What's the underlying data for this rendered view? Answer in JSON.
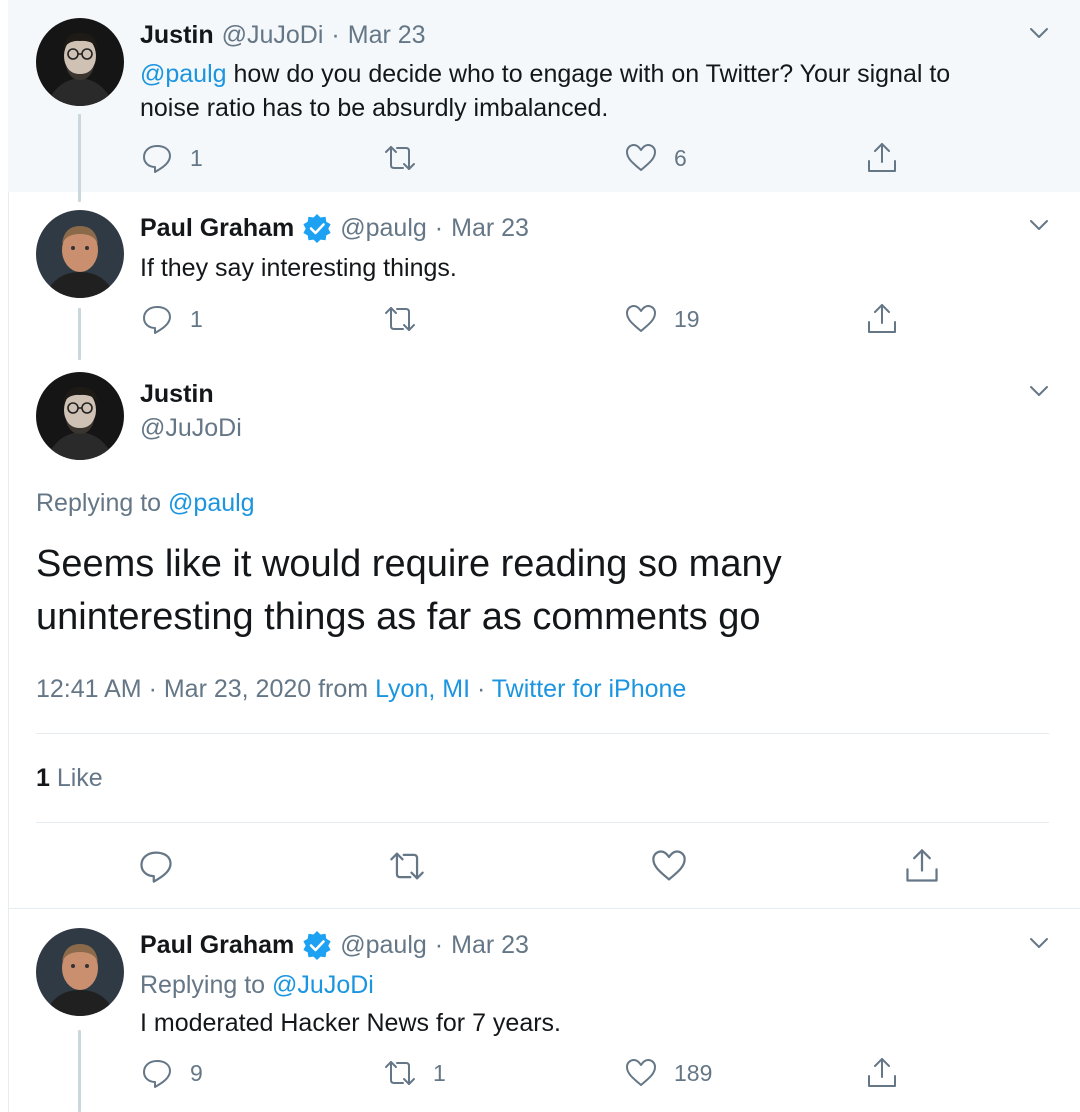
{
  "tweets": [
    {
      "name": "Justin",
      "handle": "@JuJoDi",
      "date": "Mar 23",
      "mention": "@paulg",
      "text_line1": " how do you decide who to engage with on Twitter? Your signal to",
      "text_line2": "noise ratio has to be absurdly imbalanced.",
      "reply_count": "1",
      "retweet_count": "",
      "like_count": "6"
    },
    {
      "name": "Paul Graham",
      "handle": "@paulg",
      "date": "Mar 23",
      "text": "If they say interesting things.",
      "reply_count": "1",
      "retweet_count": "",
      "like_count": "19"
    }
  ],
  "focus": {
    "name": "Justin",
    "handle": "@JuJoDi",
    "replying_prefix": "Replying to ",
    "replying_to": "@paulg",
    "text_line1": "Seems like it would require reading so many",
    "text_line2": "uninteresting things as far as comments go",
    "time": "12:41 AM · Mar 23, 2020 from ",
    "location": "Lyon, MI",
    "sep": " · ",
    "source": "Twitter for iPhone",
    "likes_number": "1",
    "likes_label": " Like"
  },
  "reply": {
    "name": "Paul Graham",
    "handle": "@paulg",
    "date": "Mar 23",
    "replying_prefix": "Replying to ",
    "replying_to": "@JuJoDi",
    "text": "I moderated Hacker News for 7 years.",
    "reply_count": "9",
    "retweet_count": "1",
    "like_count": "189"
  },
  "separator": "·",
  "colors": {
    "link": "#1b95e0",
    "muted": "#657786",
    "verified": "#1da1f2",
    "thread_bg": "#f5f8fa"
  },
  "icons": [
    "reply-icon",
    "retweet-icon",
    "like-icon",
    "share-icon",
    "chevron-down-icon",
    "verified-badge-icon"
  ]
}
